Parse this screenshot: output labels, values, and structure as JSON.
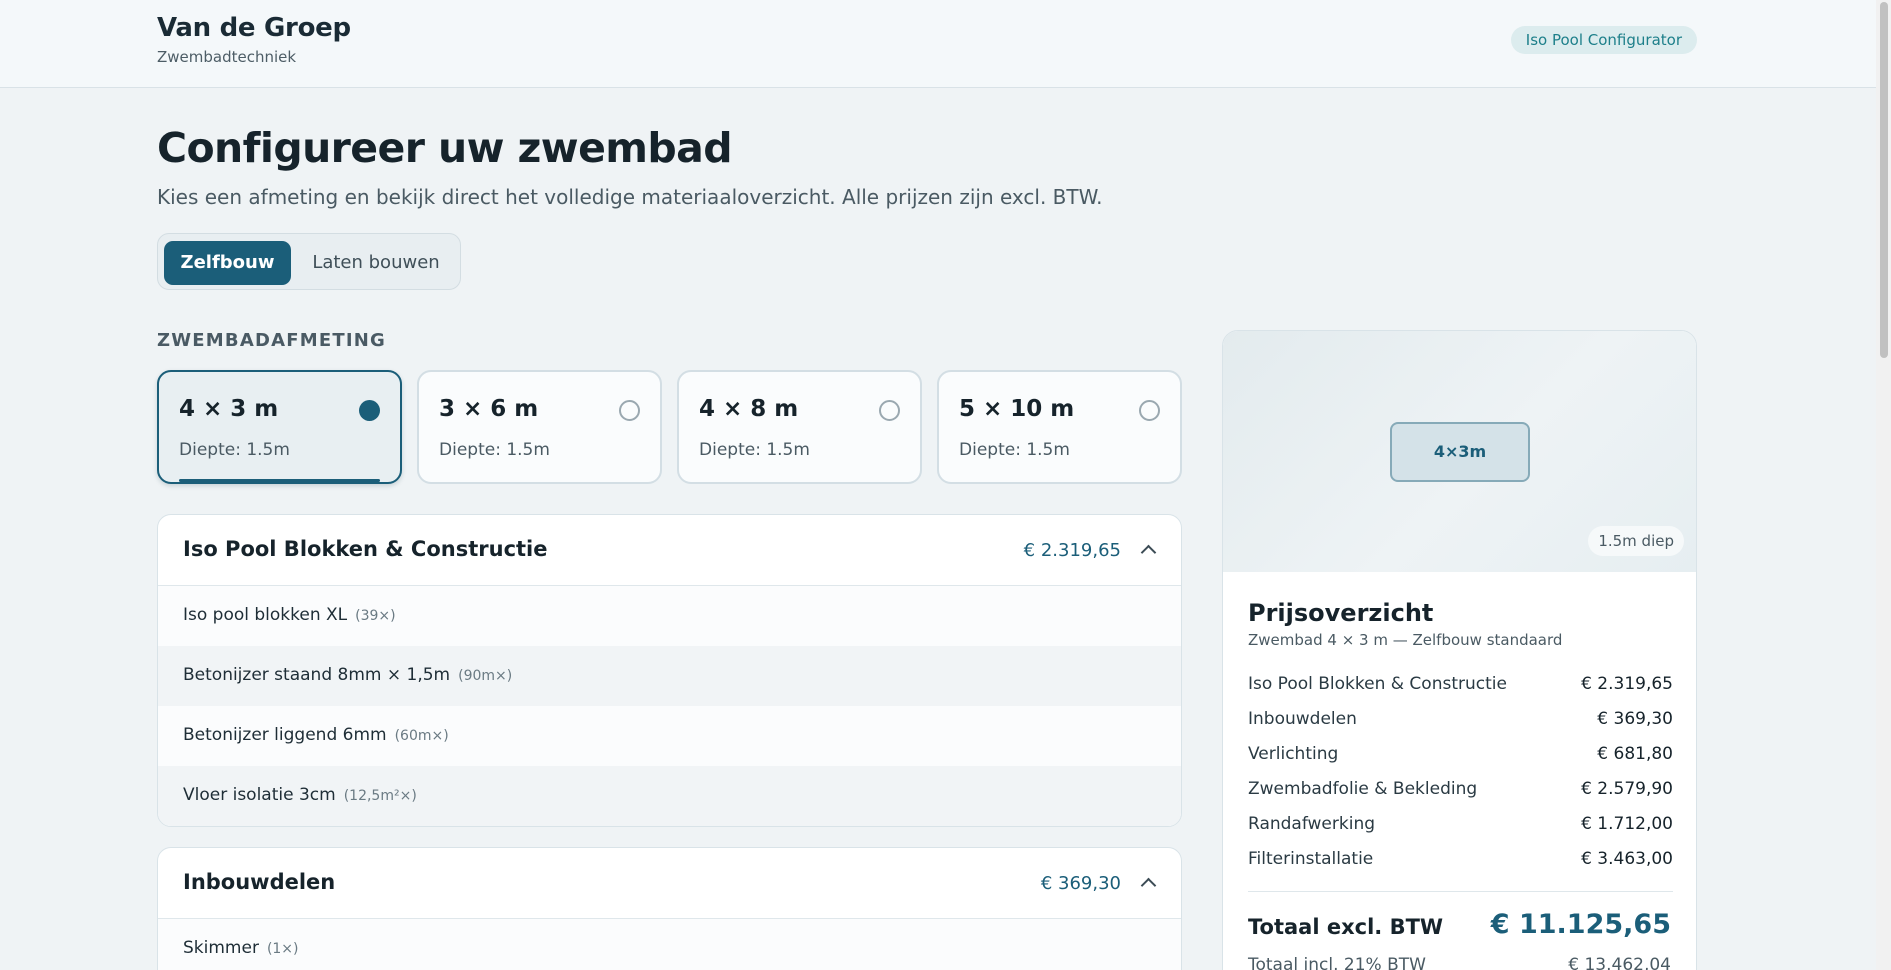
{
  "header": {
    "brand": "Van de Groep",
    "brand_sub": "Zwembadtechniek",
    "badge": "Iso Pool Configurator"
  },
  "hero": {
    "title": "Configureer uw zwembad",
    "subtitle": "Kies een afmeting en bekijk direct het volledige materiaaloverzicht. Alle prijzen zijn excl. BTW."
  },
  "mode": {
    "options": [
      "Zelfbouw",
      "Laten bouwen"
    ],
    "selected": "Zelfbouw"
  },
  "sizes": {
    "label": "ZWEMBADAFMETING",
    "items": [
      {
        "name": "4 × 3 m",
        "depth": "Diepte: 1.5m",
        "selected": true
      },
      {
        "name": "3 × 6 m",
        "depth": "Diepte: 1.5m",
        "selected": false
      },
      {
        "name": "4 × 8 m",
        "depth": "Diepte: 1.5m",
        "selected": false
      },
      {
        "name": "5 × 10 m",
        "depth": "Diepte: 1.5m",
        "selected": false
      }
    ]
  },
  "categories": [
    {
      "title": "Iso Pool Blokken & Constructie",
      "price": "€ 2.319,65",
      "items": [
        {
          "name": "Iso pool blokken XL",
          "qty": "(39×)"
        },
        {
          "name": "Betonijzer staand 8mm × 1,5m",
          "qty": "(90m×)"
        },
        {
          "name": "Betonijzer liggend 6mm",
          "qty": "(60m×)"
        },
        {
          "name": "Vloer isolatie 3cm",
          "qty": "(12,5m²×)"
        }
      ]
    },
    {
      "title": "Inbouwdelen",
      "price": "€ 369,30",
      "items": [
        {
          "name": "Skimmer",
          "qty": "(1×)"
        }
      ]
    }
  ],
  "preview": {
    "pool_label": "4×3m",
    "depth_badge": "1.5m diep"
  },
  "summary": {
    "title": "Prijsoverzicht",
    "subtitle": "Zwembad 4 × 3 m — Zelfbouw standaard",
    "rows": [
      {
        "label": "Iso Pool Blokken & Constructie",
        "value": "€ 2.319,65"
      },
      {
        "label": "Inbouwdelen",
        "value": "€ 369,30"
      },
      {
        "label": "Verlichting",
        "value": "€ 681,80"
      },
      {
        "label": "Zwembadfolie & Bekleding",
        "value": "€ 2.579,90"
      },
      {
        "label": "Randafwerking",
        "value": "€ 1.712,00"
      },
      {
        "label": "Filterinstallatie",
        "value": "€ 3.463,00"
      }
    ],
    "total_label": "Totaal excl. BTW",
    "total_value": "€ 11.125,65",
    "incl_label": "Totaal incl. 21% BTW",
    "incl_value": "€ 13.462,04"
  },
  "colors": {
    "accent": "#1b5e79",
    "badge_text": "#1d7f8a",
    "background": "#eff3f5"
  }
}
